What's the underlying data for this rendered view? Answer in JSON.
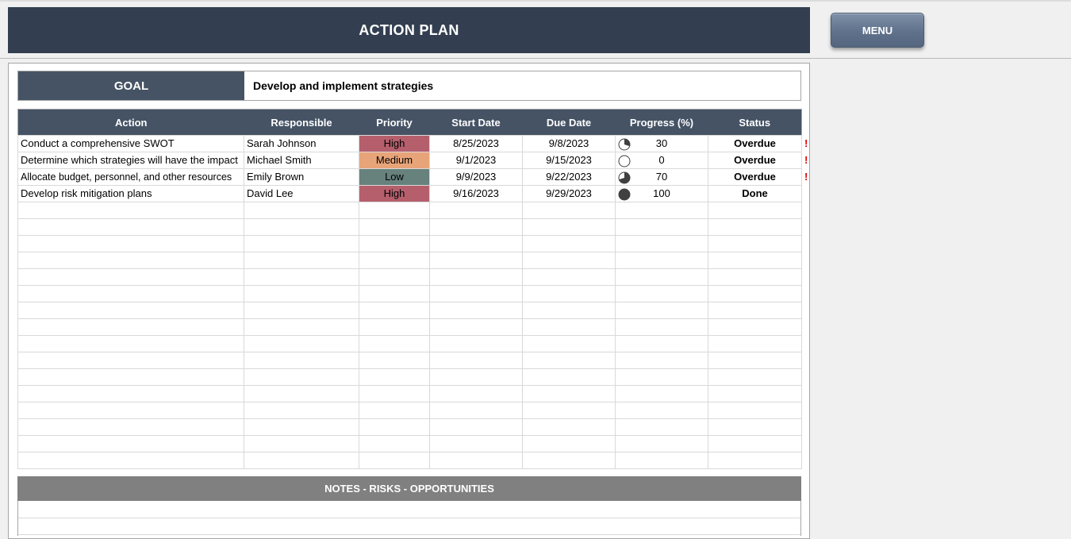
{
  "header": {
    "title": "ACTION PLAN",
    "menu_label": "MENU"
  },
  "goal": {
    "label": "GOAL",
    "value": "Develop and implement strategies"
  },
  "table": {
    "columns": [
      "Action",
      "Responsible",
      "Priority",
      "Start Date",
      "Due Date",
      "Progress (%)",
      "Status"
    ],
    "rows": [
      {
        "action": "Conduct a comprehensive SWOT",
        "responsible": "Sarah Johnson",
        "priority": "High",
        "start": "8/25/2023",
        "due": "9/8/2023",
        "progress": "30",
        "status": "Overdue",
        "flag": "!"
      },
      {
        "action": "Determine which strategies will have the impact",
        "responsible": "Michael Smith",
        "priority": "Medium",
        "start": "9/1/2023",
        "due": "9/15/2023",
        "progress": "0",
        "status": "Overdue",
        "flag": "!"
      },
      {
        "action": "Allocate budget, personnel, and other resources",
        "responsible": "Emily Brown",
        "priority": "Low",
        "start": "9/9/2023",
        "due": "9/22/2023",
        "progress": "70",
        "status": "Overdue",
        "flag": "!"
      },
      {
        "action": "Develop risk mitigation plans",
        "responsible": "David Lee",
        "priority": "High",
        "start": "9/16/2023",
        "due": "9/29/2023",
        "progress": "100",
        "status": "Done",
        "flag": ""
      }
    ],
    "empty_rows": 16
  },
  "notes": {
    "title": "NOTES - RISKS - OPPORTUNITIES"
  },
  "colors": {
    "header_bg": "#333f50",
    "table_header_bg": "#455365",
    "priority_high": "#b55f6c",
    "priority_medium": "#e8a479",
    "priority_low": "#67817d",
    "status_text": "#2f4f8f",
    "overdue_flag": "#e00000",
    "notes_bar": "#808080"
  },
  "icons": {
    "progress": "progress-pie-icon",
    "overdue": "exclamation-icon"
  }
}
